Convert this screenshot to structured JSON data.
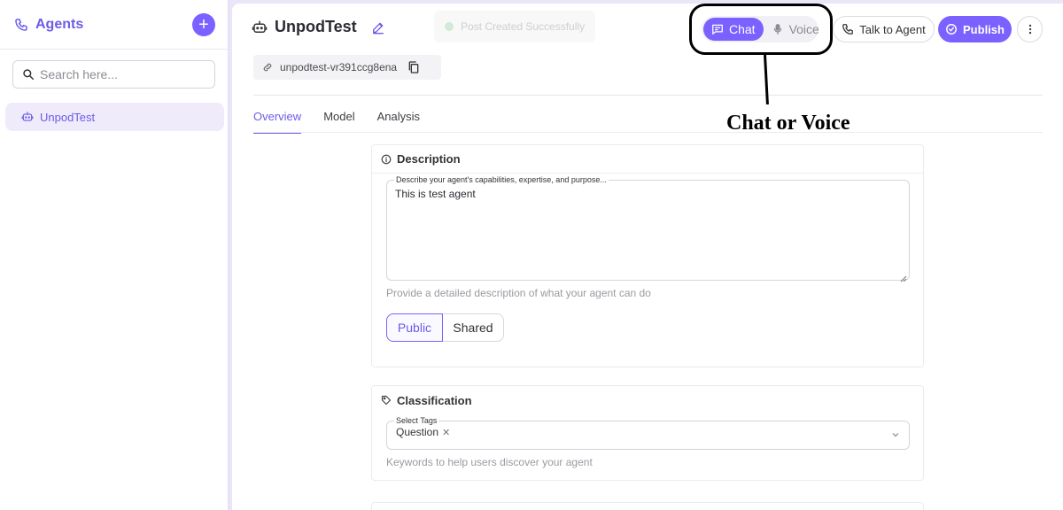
{
  "sidebar": {
    "title": "Agents",
    "add_label": "+",
    "search_placeholder": "Search here...",
    "items": [
      {
        "label": "UnpodTest"
      }
    ]
  },
  "header": {
    "agent_name": "UnpodTest",
    "slug": "unpodtest-vr391ccg8ena",
    "toast": "Post Created Successfully"
  },
  "toolbar": {
    "mode_options": [
      "Chat",
      "Voice"
    ],
    "selected_mode": "Chat",
    "talk_label": "Talk to Agent",
    "publish_label": "Publish"
  },
  "tabs": [
    "Overview",
    "Model",
    "Analysis"
  ],
  "annotation": {
    "text": "Chat or Voice"
  },
  "description": {
    "title": "Description",
    "field_label": "Describe your agent's capabilities, expertise, and purpose...",
    "value": "This is test agent",
    "helper": "Provide a detailed description of what your agent can do",
    "visibility_options": [
      "Public",
      "Shared"
    ],
    "selected_visibility": "Public"
  },
  "classification": {
    "title": "Classification",
    "field_label": "Select Tags",
    "tags": [
      "Question"
    ],
    "helper": "Keywords to help users discover your agent"
  },
  "colors": {
    "accent": "#7b61ff",
    "background": "#ebe6f7"
  }
}
